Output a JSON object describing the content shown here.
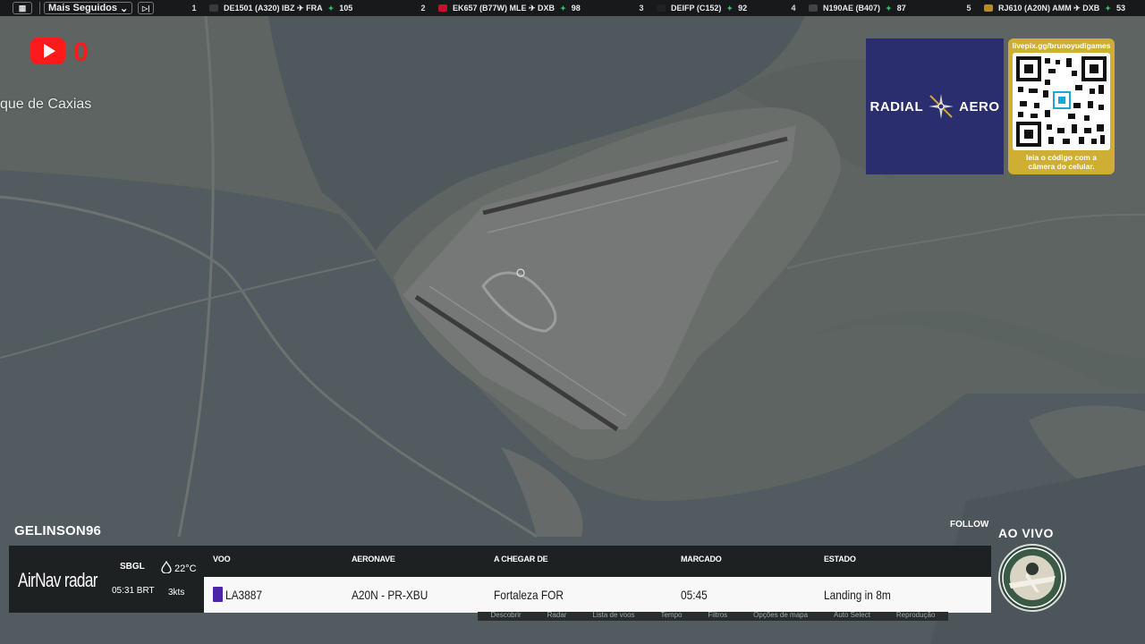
{
  "topbar": {
    "menu_icon": "grid-icon",
    "following_label": "Mais Seguidos",
    "ticker": [
      {
        "rank": "1",
        "text": "DE1501 (A320) IBZ ✈ FRA",
        "count": "105",
        "color": "#3a3a3a"
      },
      {
        "rank": "2",
        "text": "EK657 (B77W) MLE ✈ DXB",
        "count": "98",
        "color": "#c8102e"
      },
      {
        "rank": "3",
        "text": "DEIFP (C152)",
        "count": "92",
        "color": "#222"
      },
      {
        "rank": "4",
        "text": "N190AE (B407)",
        "count": "87",
        "color": "#444"
      },
      {
        "rank": "5",
        "text": "RJ610 (A20N) AMM ✈ DXB",
        "count": "53",
        "color": "#b58b2a"
      }
    ]
  },
  "map": {
    "city_label": "que de Caxias"
  },
  "youtube": {
    "count": "0"
  },
  "sponsor": {
    "left_word": "RADIAL",
    "right_word": "AERO"
  },
  "qr": {
    "url": "livepix.gg/brunoyudigames",
    "caption_line1": "leia o código com a",
    "caption_line2": "câmera do celular."
  },
  "flight": {
    "username": "GELINSON96",
    "follow_label": "FOLLOW",
    "brand": "AirNav radar",
    "weather": {
      "airport": "SBGL",
      "time": "05:31 BRT",
      "temp": "22°C",
      "wind": "3kts"
    },
    "columns": {
      "flight": "VOO",
      "aircraft": "AERONAVE",
      "from": "A CHEGAR DE",
      "scheduled": "MARCADO",
      "status": "ESTADO"
    },
    "row": {
      "flight": "LA3887",
      "aircraft": "A20N - PR-XBU",
      "from": "Fortaleza FOR",
      "scheduled": "05:45",
      "status": "Landing in 8m"
    },
    "sub_nav": [
      "Descobrir",
      "Radar",
      "Lista de voos",
      "Tempo",
      "Filtros",
      "Opções de mapa",
      "Auto Select",
      "Reprodução"
    ]
  },
  "live": {
    "label": "AO VIVO"
  }
}
